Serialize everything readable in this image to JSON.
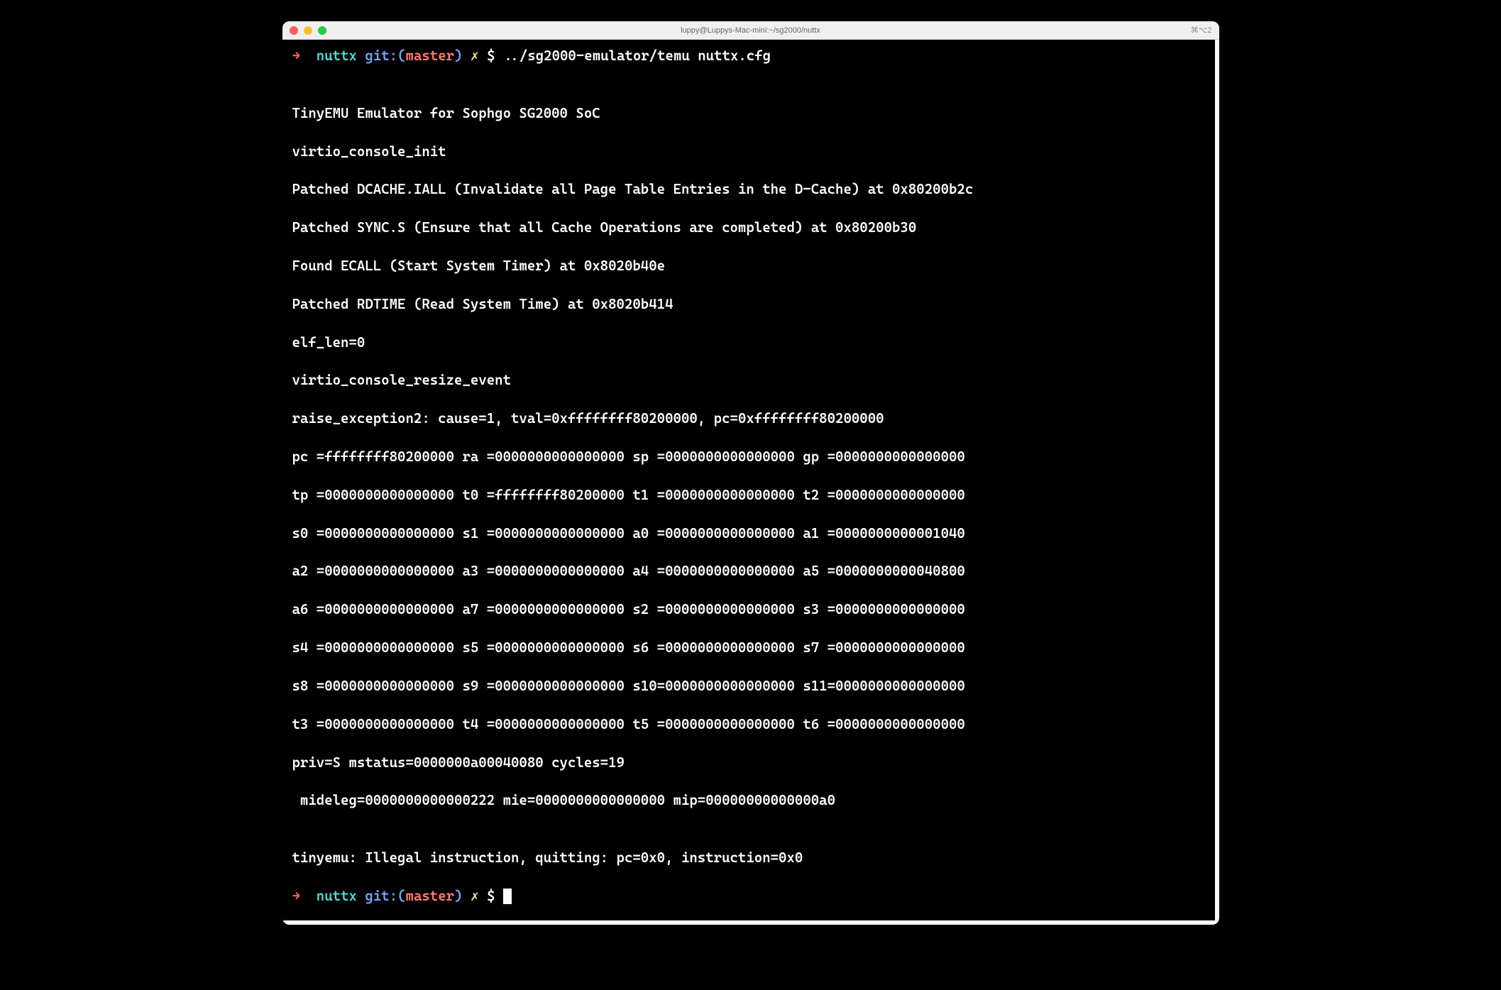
{
  "window": {
    "title": "luppy@Luppys-Mac-mini:~/sg2000/nuttx",
    "right_indicator": "⌘⌥2"
  },
  "prompt1": {
    "arrow": "→",
    "dir": "nuttx",
    "git_label": "git:(",
    "branch": "master",
    "git_close": ")",
    "mark": "✗",
    "dollar": "$",
    "command": "../sg2000-emulator/temu nuttx.cfg"
  },
  "output": {
    "l01": "TinyEMU Emulator for Sophgo SG2000 SoC",
    "l02": "virtio_console_init",
    "l03": "Patched DCACHE.IALL (Invalidate all Page Table Entries in the D-Cache) at 0x80200b2c",
    "l04": "Patched SYNC.S (Ensure that all Cache Operations are completed) at 0x80200b30",
    "l05": "Found ECALL (Start System Timer) at 0x8020b40e",
    "l06": "Patched RDTIME (Read System Time) at 0x8020b414",
    "l07": "elf_len=0",
    "l08": "virtio_console_resize_event",
    "l09": "raise_exception2: cause=1, tval=0xffffffff80200000, pc=0xffffffff80200000",
    "l10": "pc =ffffffff80200000 ra =0000000000000000 sp =0000000000000000 gp =0000000000000000",
    "l11": "tp =0000000000000000 t0 =ffffffff80200000 t1 =0000000000000000 t2 =0000000000000000",
    "l12": "s0 =0000000000000000 s1 =0000000000000000 a0 =0000000000000000 a1 =0000000000001040",
    "l13": "a2 =0000000000000000 a3 =0000000000000000 a4 =0000000000000000 a5 =0000000000040800",
    "l14": "a6 =0000000000000000 a7 =0000000000000000 s2 =0000000000000000 s3 =0000000000000000",
    "l15": "s4 =0000000000000000 s5 =0000000000000000 s6 =0000000000000000 s7 =0000000000000000",
    "l16": "s8 =0000000000000000 s9 =0000000000000000 s10=0000000000000000 s11=0000000000000000",
    "l17": "t3 =0000000000000000 t4 =0000000000000000 t5 =0000000000000000 t6 =0000000000000000",
    "l18": "priv=S mstatus=0000000a00040080 cycles=19",
    "l19": " mideleg=0000000000000222 mie=0000000000000000 mip=00000000000000a0",
    "l20": "",
    "l21": "tinyemu: Illegal instruction, quitting: pc=0x0, instruction=0x0"
  },
  "prompt2": {
    "arrow": "→",
    "dir": "nuttx",
    "git_label": "git:(",
    "branch": "master",
    "git_close": ")",
    "mark": "✗",
    "dollar": "$"
  }
}
